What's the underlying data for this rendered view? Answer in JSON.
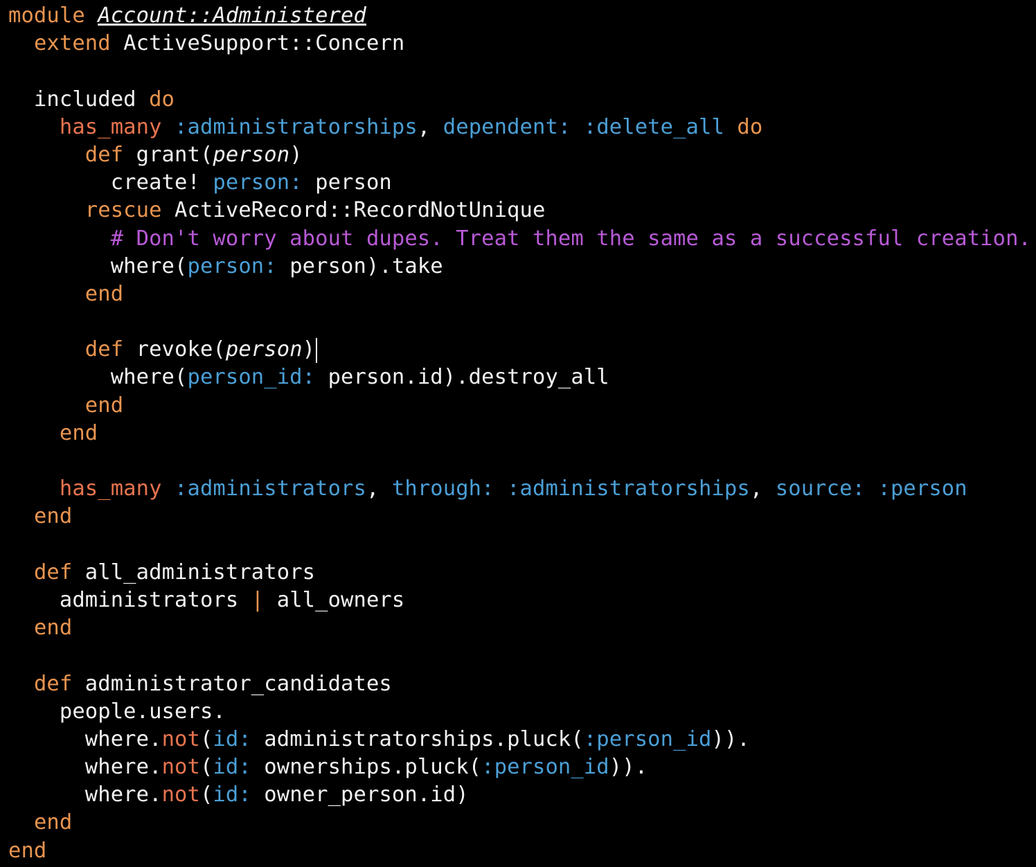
{
  "colors": {
    "background": "#000000",
    "text": "#f2f2f2",
    "keyword": "#e8944f",
    "association": "#e8744f",
    "symbol": "#4b9fd6",
    "comment": "#b85ad6"
  },
  "lines": [
    [
      {
        "t": "module ",
        "c": "kw"
      },
      {
        "t": "Account::Administered",
        "c": "const-italic"
      }
    ],
    [
      {
        "t": "  "
      },
      {
        "t": "extend ",
        "c": "kw"
      },
      {
        "t": "ActiveSupport::Concern",
        "c": "plain"
      }
    ],
    [],
    [
      {
        "t": "  included ",
        "c": "plain"
      },
      {
        "t": "do",
        "c": "kw"
      }
    ],
    [
      {
        "t": "    "
      },
      {
        "t": "has_many",
        "c": "method"
      },
      {
        "t": " :administratorships",
        "c": "sym"
      },
      {
        "t": ", ",
        "c": "plain"
      },
      {
        "t": "dependent: :delete_all",
        "c": "sym"
      },
      {
        "t": " do",
        "c": "kw"
      }
    ],
    [
      {
        "t": "      "
      },
      {
        "t": "def",
        "c": "def"
      },
      {
        "t": " grant(",
        "c": "plain"
      },
      {
        "t": "person",
        "c": "param"
      },
      {
        "t": ")",
        "c": "plain"
      }
    ],
    [
      {
        "t": "        create! ",
        "c": "plain"
      },
      {
        "t": "person:",
        "c": "sym"
      },
      {
        "t": " person",
        "c": "plain"
      }
    ],
    [
      {
        "t": "      "
      },
      {
        "t": "rescue",
        "c": "kw"
      },
      {
        "t": " ActiveRecord::RecordNotUnique",
        "c": "plain"
      }
    ],
    [
      {
        "t": "        "
      },
      {
        "t": "# Don't worry about dupes. Treat them the same as a successful creation.",
        "c": "comment"
      }
    ],
    [
      {
        "t": "        where(",
        "c": "plain"
      },
      {
        "t": "person:",
        "c": "sym"
      },
      {
        "t": " person).take",
        "c": "plain"
      }
    ],
    [
      {
        "t": "      "
      },
      {
        "t": "end",
        "c": "kw"
      }
    ],
    [],
    [
      {
        "t": "      "
      },
      {
        "t": "def",
        "c": "def"
      },
      {
        "t": " revoke(",
        "c": "plain"
      },
      {
        "t": "person",
        "c": "param"
      },
      {
        "t": ")",
        "c": "plain"
      },
      {
        "cursor": true
      }
    ],
    [
      {
        "t": "        where(",
        "c": "plain"
      },
      {
        "t": "person_id:",
        "c": "sym"
      },
      {
        "t": " person.id).destroy_all",
        "c": "plain"
      }
    ],
    [
      {
        "t": "      "
      },
      {
        "t": "end",
        "c": "kw"
      }
    ],
    [
      {
        "t": "    "
      },
      {
        "t": "end",
        "c": "kw"
      }
    ],
    [],
    [
      {
        "t": "    "
      },
      {
        "t": "has_many",
        "c": "method"
      },
      {
        "t": " :administrators",
        "c": "sym"
      },
      {
        "t": ", ",
        "c": "plain"
      },
      {
        "t": "through: :administratorships",
        "c": "sym"
      },
      {
        "t": ", ",
        "c": "plain"
      },
      {
        "t": "source: :person",
        "c": "sym"
      }
    ],
    [
      {
        "t": "  "
      },
      {
        "t": "end",
        "c": "kw"
      }
    ],
    [],
    [
      {
        "t": "  "
      },
      {
        "t": "def",
        "c": "def"
      },
      {
        "t": " all_administrators",
        "c": "plain"
      }
    ],
    [
      {
        "t": "    administrators ",
        "c": "plain"
      },
      {
        "t": "|",
        "c": "op"
      },
      {
        "t": " all_owners",
        "c": "plain"
      }
    ],
    [
      {
        "t": "  "
      },
      {
        "t": "end",
        "c": "kw"
      }
    ],
    [],
    [
      {
        "t": "  "
      },
      {
        "t": "def",
        "c": "def"
      },
      {
        "t": " administrator_candidates",
        "c": "plain"
      }
    ],
    [
      {
        "t": "    people.users.",
        "c": "plain"
      }
    ],
    [
      {
        "t": "      where.",
        "c": "plain"
      },
      {
        "t": "not",
        "c": "method"
      },
      {
        "t": "(",
        "c": "plain"
      },
      {
        "t": "id:",
        "c": "sym"
      },
      {
        "t": " administratorships.pluck(",
        "c": "plain"
      },
      {
        "t": ":person_id",
        "c": "sym"
      },
      {
        "t": ")).",
        "c": "plain"
      }
    ],
    [
      {
        "t": "      where.",
        "c": "plain"
      },
      {
        "t": "not",
        "c": "method"
      },
      {
        "t": "(",
        "c": "plain"
      },
      {
        "t": "id:",
        "c": "sym"
      },
      {
        "t": " ownerships.pluck(",
        "c": "plain"
      },
      {
        "t": ":person_id",
        "c": "sym"
      },
      {
        "t": ")).",
        "c": "plain"
      }
    ],
    [
      {
        "t": "      where.",
        "c": "plain"
      },
      {
        "t": "not",
        "c": "method"
      },
      {
        "t": "(",
        "c": "plain"
      },
      {
        "t": "id:",
        "c": "sym"
      },
      {
        "t": " owner_person.id)",
        "c": "plain"
      }
    ],
    [
      {
        "t": "  "
      },
      {
        "t": "end",
        "c": "kw"
      }
    ],
    [
      {
        "t": "end",
        "c": "kw"
      }
    ]
  ]
}
